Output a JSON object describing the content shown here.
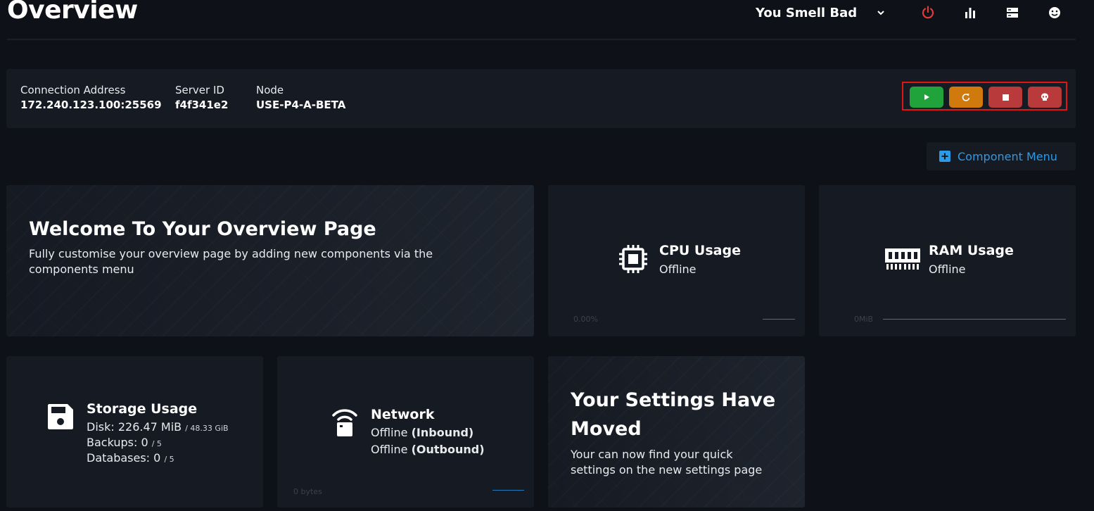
{
  "header": {
    "title": "Overview",
    "user_name": "You Smell Bad",
    "icons": [
      "chevron-down-icon",
      "power-icon",
      "bar-chart-icon",
      "server-icon",
      "smiley-icon"
    ]
  },
  "server_info": {
    "connection_label": "Connection Address",
    "connection_value": "172.240.123.100:25569",
    "server_id_label": "Server ID",
    "server_id_value": "f4f341e2",
    "node_label": "Node",
    "node_value": "USE-P4-A-BETA"
  },
  "power_buttons": [
    {
      "name": "start",
      "icon": "play-icon",
      "color": "#1fa33a"
    },
    {
      "name": "restart",
      "icon": "restart-icon",
      "color": "#d07a0d"
    },
    {
      "name": "stop",
      "icon": "stop-icon",
      "color": "#b83a3a"
    },
    {
      "name": "kill",
      "icon": "skull-icon",
      "color": "#b83a3a"
    }
  ],
  "component_menu": {
    "label": "Component Menu",
    "icon": "plus-square-icon"
  },
  "welcome": {
    "title": "Welcome To Your Overview Page",
    "text": "Fully customise your overview page by adding new components via the components menu"
  },
  "cpu": {
    "title": "CPU Usage",
    "status": "Offline",
    "graph_label": "0.00%"
  },
  "ram": {
    "title": "RAM Usage",
    "status": "Offline",
    "graph_label": "0MiB"
  },
  "storage": {
    "title": "Storage Usage",
    "disk_label": "Disk: 226.47 MiB",
    "disk_total": "/ 48.33 GiB",
    "backups_label": "Backups: 0",
    "backups_total": "/ 5",
    "databases_label": "Databases: 0",
    "databases_total": "/ 5"
  },
  "network": {
    "title": "Network",
    "inbound_status": "Offline",
    "inbound_label": "(Inbound)",
    "outbound_status": "Offline",
    "outbound_label": "(Outbound)",
    "graph_label": "0 bytes"
  },
  "settings_moved": {
    "title_line1": "Your Settings Have",
    "title_line2": "Moved",
    "text_line1": "Your can now find your quick",
    "text_line2": "settings on the new settings page"
  },
  "colors": {
    "accent": "#2b9be8",
    "background": "#0e1118",
    "card": "#161a23",
    "power": "#e03a3a"
  }
}
